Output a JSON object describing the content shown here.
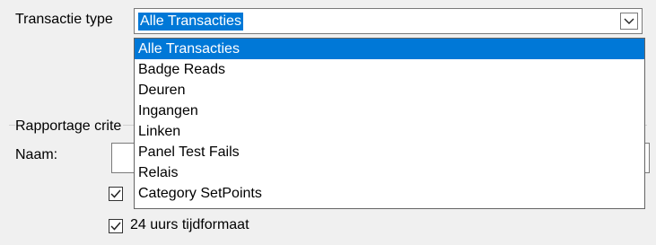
{
  "form": {
    "transaction_type_label": "Transactie type",
    "selected_value": "Alle Transacties",
    "dropdown_icon": "chevron-down-icon",
    "options": [
      "Alle Transacties",
      "Badge Reads",
      "Deuren",
      "Ingangen",
      "Linken",
      "Panel Test Fails",
      "Relais",
      "Category SetPoints"
    ],
    "report_criteria_label": "Rapportage crite",
    "name_label": "Naam:",
    "name_value": "",
    "checkbox1_checked": true,
    "checkbox2_label": "24 uurs tijdformaat",
    "checkbox2_checked": true
  },
  "colors": {
    "selection": "#0078d7",
    "background": "#f0f0f0"
  }
}
